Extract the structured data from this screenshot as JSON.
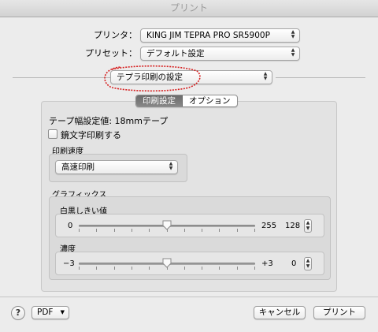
{
  "window": {
    "title": "プリント"
  },
  "printer": {
    "label": "プリンタ：",
    "value": "KING JIM TEPRA PRO SR5900P"
  },
  "preset": {
    "label": "プリセット：",
    "value": "デフォルト設定"
  },
  "panel_menu": {
    "value": "テプラ印刷の設定"
  },
  "tabs": [
    {
      "label": "印刷設定",
      "selected": true
    },
    {
      "label": "オプション",
      "selected": false
    }
  ],
  "tape_width": {
    "text": "テープ幅設定値: 18mmテープ"
  },
  "mirror": {
    "label": "鏡文字印刷する",
    "checked": false
  },
  "print_speed": {
    "section_label": "印刷速度",
    "value": "高速印刷"
  },
  "graphics": {
    "section_label": "グラフィックス",
    "threshold": {
      "label": "白黒しきい値",
      "min": "0",
      "max": "255",
      "value": "128",
      "level": 0.5
    },
    "density": {
      "label": "濃度",
      "min": "−3",
      "max": "+3",
      "value": "0",
      "level": 0.5
    }
  },
  "footer": {
    "help": "?",
    "pdf_label": "PDF",
    "cancel_label": "キャンセル",
    "print_label": "プリント"
  },
  "annotation": {
    "color": "#d62020"
  }
}
